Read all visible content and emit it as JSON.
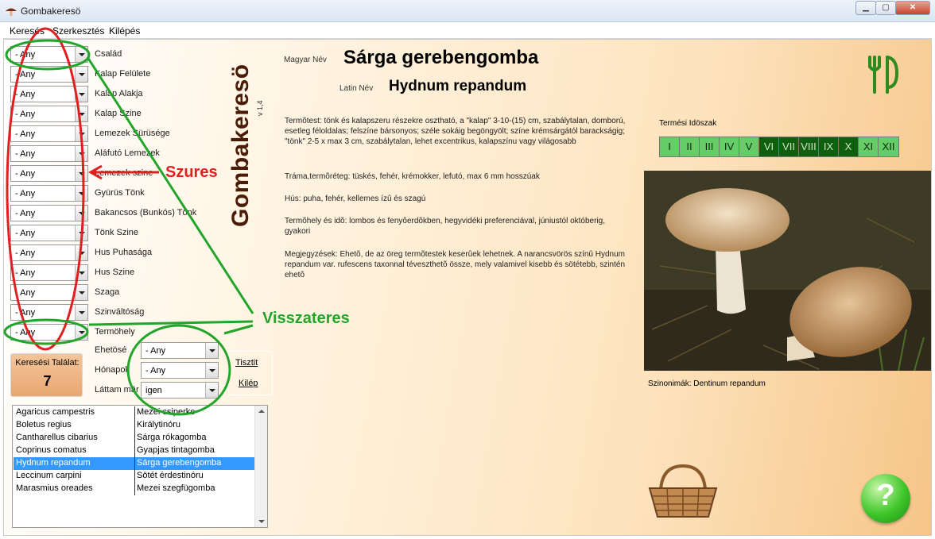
{
  "window": {
    "title": "Gombakeresö",
    "min_label": "▁",
    "max_label": "▢",
    "close_label": "✕"
  },
  "menu": [
    "Keresés",
    "Szerkesztés",
    "Kilépés"
  ],
  "app_title": "Gombakeresö",
  "version": "v 1,4",
  "filters": [
    {
      "value": "- Any",
      "label": "Család"
    },
    {
      "value": "- Any",
      "label": "Kalap Felülete"
    },
    {
      "value": "- Any",
      "label": "Kalap Alakja"
    },
    {
      "value": "- Any",
      "label": "Kalap Szine"
    },
    {
      "value": "- Any",
      "label": "Lemezek Sürüsége"
    },
    {
      "value": "- Any",
      "label": "Aláfutó Lemezek"
    },
    {
      "value": "- Any",
      "label": "Lemezek szine"
    },
    {
      "value": "- Any",
      "label": "Gyürüs Tönk"
    },
    {
      "value": "- Any",
      "label": "Bakancsos (Bunkós) Tönk"
    },
    {
      "value": "- Any",
      "label": "Tönk Szine"
    },
    {
      "value": "- Any",
      "label": "Hus Puhasága"
    },
    {
      "value": "- Any",
      "label": "Hus Szine"
    },
    {
      "value": "- Any",
      "label": "Szaga"
    },
    {
      "value": "- Any",
      "label": "Szinváltóság"
    },
    {
      "value": "- Any",
      "label": "Termöhely"
    }
  ],
  "extra_filters": [
    {
      "label": "Ehetösé",
      "value": "- Any"
    },
    {
      "label": "Hónapok",
      "value": "- Any"
    },
    {
      "label": "Láttam már",
      "value": "igen"
    }
  ],
  "hits": {
    "label": "Keresési Találat:",
    "count": "7"
  },
  "buttons": {
    "clear": "Tisztit",
    "exit": "Kilép"
  },
  "results": [
    {
      "latin": "Agaricus campestris",
      "hu": "Mezei csiperke",
      "selected": false
    },
    {
      "latin": "Boletus regius",
      "hu": "Királytinóru",
      "selected": false
    },
    {
      "latin": "Cantharellus cibarius",
      "hu": "Sárga rókagomba",
      "selected": false
    },
    {
      "latin": "Coprinus comatus",
      "hu": "Gyapjas tintagomba",
      "selected": false
    },
    {
      "latin": "Hydnum repandum",
      "hu": "Sárga gerebengomba",
      "selected": true
    },
    {
      "latin": "Leccinum carpini",
      "hu": "Sötét érdestinóru",
      "selected": false
    },
    {
      "latin": "Marasmius oreades",
      "hu": "Mezei szegfügomba",
      "selected": false
    }
  ],
  "detail": {
    "hu_label": "Magyar Név",
    "hu_name": "Sárga gerebengomba",
    "latin_label": "Latin Név",
    "latin_name": "Hydnum repandum",
    "termotest": "Termõtest: tönk és kalapszeru részekre osztható, a \"kalap\" 3-10-(15) cm, szabálytalan, domború, esetleg féloldalas; felszíne bársonyos; széle sokáig begöngyölt; színe krémsárgától barackságig; \"tönk\" 2-5 x max 3 cm, szabálytalan, lehet excentrikus, kalapszínu vagy világosabb",
    "trama": "Tráma,termõréteg: tüskés, fehér, krémokker, lefutó, max 6 mm hosszúak",
    "hus": "Hús: puha, fehér, kellemes ízû és szagú",
    "termohely": "Termõhely és idõ: lombos és fenyõerdõkben, hegyvidéki preferenciával, júniustól októberig, gyakori",
    "megjegyzes": "Megjegyzések: Ehetõ, de az öreg termõtestek keserûek lehetnek. A narancsvörös színû Hydnum repandum var. rufescens taxonnal téveszthetõ össze, mely valamivel kisebb és sötétebb, szintén ehetõ",
    "synonyms": "Szinonimák: Dentinum repandum"
  },
  "season": {
    "title": "Termési Idöszak",
    "months": [
      {
        "label": "I",
        "active": true
      },
      {
        "label": "II",
        "active": true
      },
      {
        "label": "III",
        "active": true
      },
      {
        "label": "IV",
        "active": true
      },
      {
        "label": "V",
        "active": true
      },
      {
        "label": "VI",
        "active": false
      },
      {
        "label": "VII",
        "active": false
      },
      {
        "label": "VIII",
        "active": false
      },
      {
        "label": "IX",
        "active": false
      },
      {
        "label": "X",
        "active": false
      },
      {
        "label": "XI",
        "active": true
      },
      {
        "label": "XII",
        "active": true
      }
    ],
    "active_color": "#66cc66",
    "inactive_color": "#0f5f0f"
  },
  "help_label": "?",
  "annotations": {
    "szures": "Szures",
    "visszateres": "Visszateres"
  },
  "colors": {
    "annotation_red": "#e02020",
    "annotation_green": "#22a52a",
    "selection_blue": "#3399ff",
    "title_brown": "#4a1c06"
  }
}
